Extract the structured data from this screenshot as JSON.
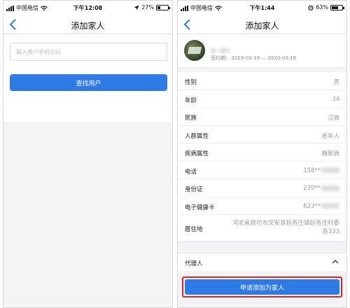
{
  "left": {
    "status": {
      "carrier": "中国电信",
      "time": "下午12:08",
      "battery_text": "27%",
      "battery_level": 0.27
    },
    "nav": {
      "title": "添加家人"
    },
    "phone_input": {
      "placeholder": "输入用户手机号码"
    },
    "search_button": {
      "label": "查找用户"
    }
  },
  "right": {
    "status": {
      "carrier": "中国电信",
      "time": "下午1:44",
      "battery_text": "63%",
      "battery_level": 0.63
    },
    "nav": {
      "title": "添加家人"
    },
    "profile": {
      "name": "",
      "team": "家一团队",
      "sign_label": "签约期:",
      "sign_period": "2019-03-19 — 2020-03-18"
    },
    "info": [
      {
        "label": "性别",
        "value": "男"
      },
      {
        "label": "年龄",
        "value": "34"
      },
      {
        "label": "民族",
        "value": "汉族"
      },
      {
        "label": "人群属性",
        "value": "老年人"
      },
      {
        "label": "疾病属性",
        "value": "糖尿病"
      },
      {
        "label": "电话",
        "value": "158**"
      },
      {
        "label": "身份证",
        "value": "230**"
      },
      {
        "label": "电子健康卡",
        "value": "623**"
      }
    ],
    "address": {
      "label": "居住地",
      "value": "河北省廊坊市文安县赵各庄镇赵各庄村委会333"
    },
    "agent": {
      "label": "代理人"
    },
    "apply_button": {
      "label": "申请添加为家人"
    }
  }
}
